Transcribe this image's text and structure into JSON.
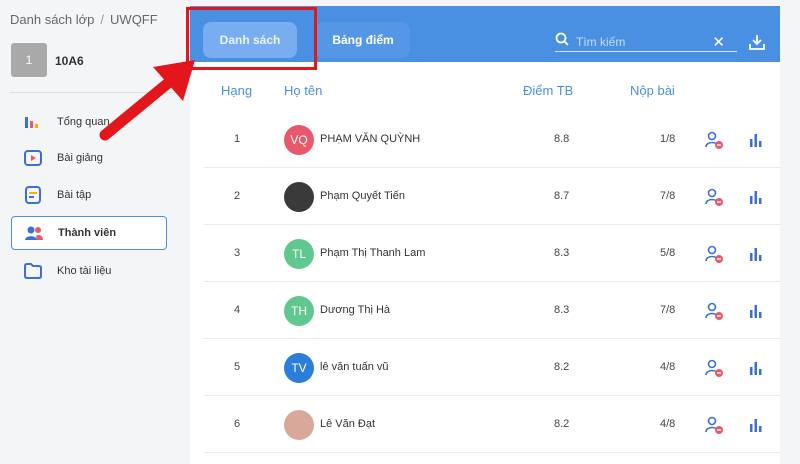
{
  "breadcrumb": {
    "root": "Danh sách lớp",
    "separator": "/",
    "code": "UWQFF"
  },
  "class_info": {
    "number": "1",
    "name": "10A6"
  },
  "nav": [
    {
      "label": "Tổng quan",
      "icon": "overview-icon"
    },
    {
      "label": "Bài giảng",
      "icon": "lecture-icon"
    },
    {
      "label": "Bài tập",
      "icon": "assignment-icon"
    },
    {
      "label": "Thành viên",
      "icon": "members-icon",
      "active": true
    },
    {
      "label": "Kho tài liệu",
      "icon": "folder-icon"
    }
  ],
  "tabs": {
    "list": "Danh sách",
    "grades": "Bảng điểm"
  },
  "search": {
    "placeholder": "Tìm kiếm"
  },
  "columns": {
    "rank": "Hạng",
    "name": "Họ tên",
    "score": "Điểm TB",
    "submitted": "Nộp bài"
  },
  "rows": [
    {
      "rank": "1",
      "initials": "VQ",
      "avatar_color": "#e85a6b",
      "name": "PHẠM VĂN QUỲNH",
      "score": "8.8",
      "submitted": "1/8"
    },
    {
      "rank": "2",
      "initials": "",
      "avatar_color": "#3a3a3a",
      "name": "Phạm Quyết Tiến",
      "score": "8.7",
      "submitted": "7/8"
    },
    {
      "rank": "3",
      "initials": "TL",
      "avatar_color": "#5fc88f",
      "name": "Phạm Thị Thanh Lam",
      "score": "8.3",
      "submitted": "5/8"
    },
    {
      "rank": "4",
      "initials": "TH",
      "avatar_color": "#5fc88f",
      "name": "Dương Thị Hà",
      "score": "8.3",
      "submitted": "7/8"
    },
    {
      "rank": "5",
      "initials": "TV",
      "avatar_color": "#2b7fd8",
      "name": "lê văn tuấn vũ",
      "score": "8.2",
      "submitted": "4/8"
    },
    {
      "rank": "6",
      "initials": "",
      "avatar_color": "#d9a89a",
      "name": "Lê Văn Đạt",
      "score": "8.2",
      "submitted": "4/8"
    }
  ],
  "colors": {
    "accent": "#4a90e2",
    "highlight": "#e3161c"
  }
}
